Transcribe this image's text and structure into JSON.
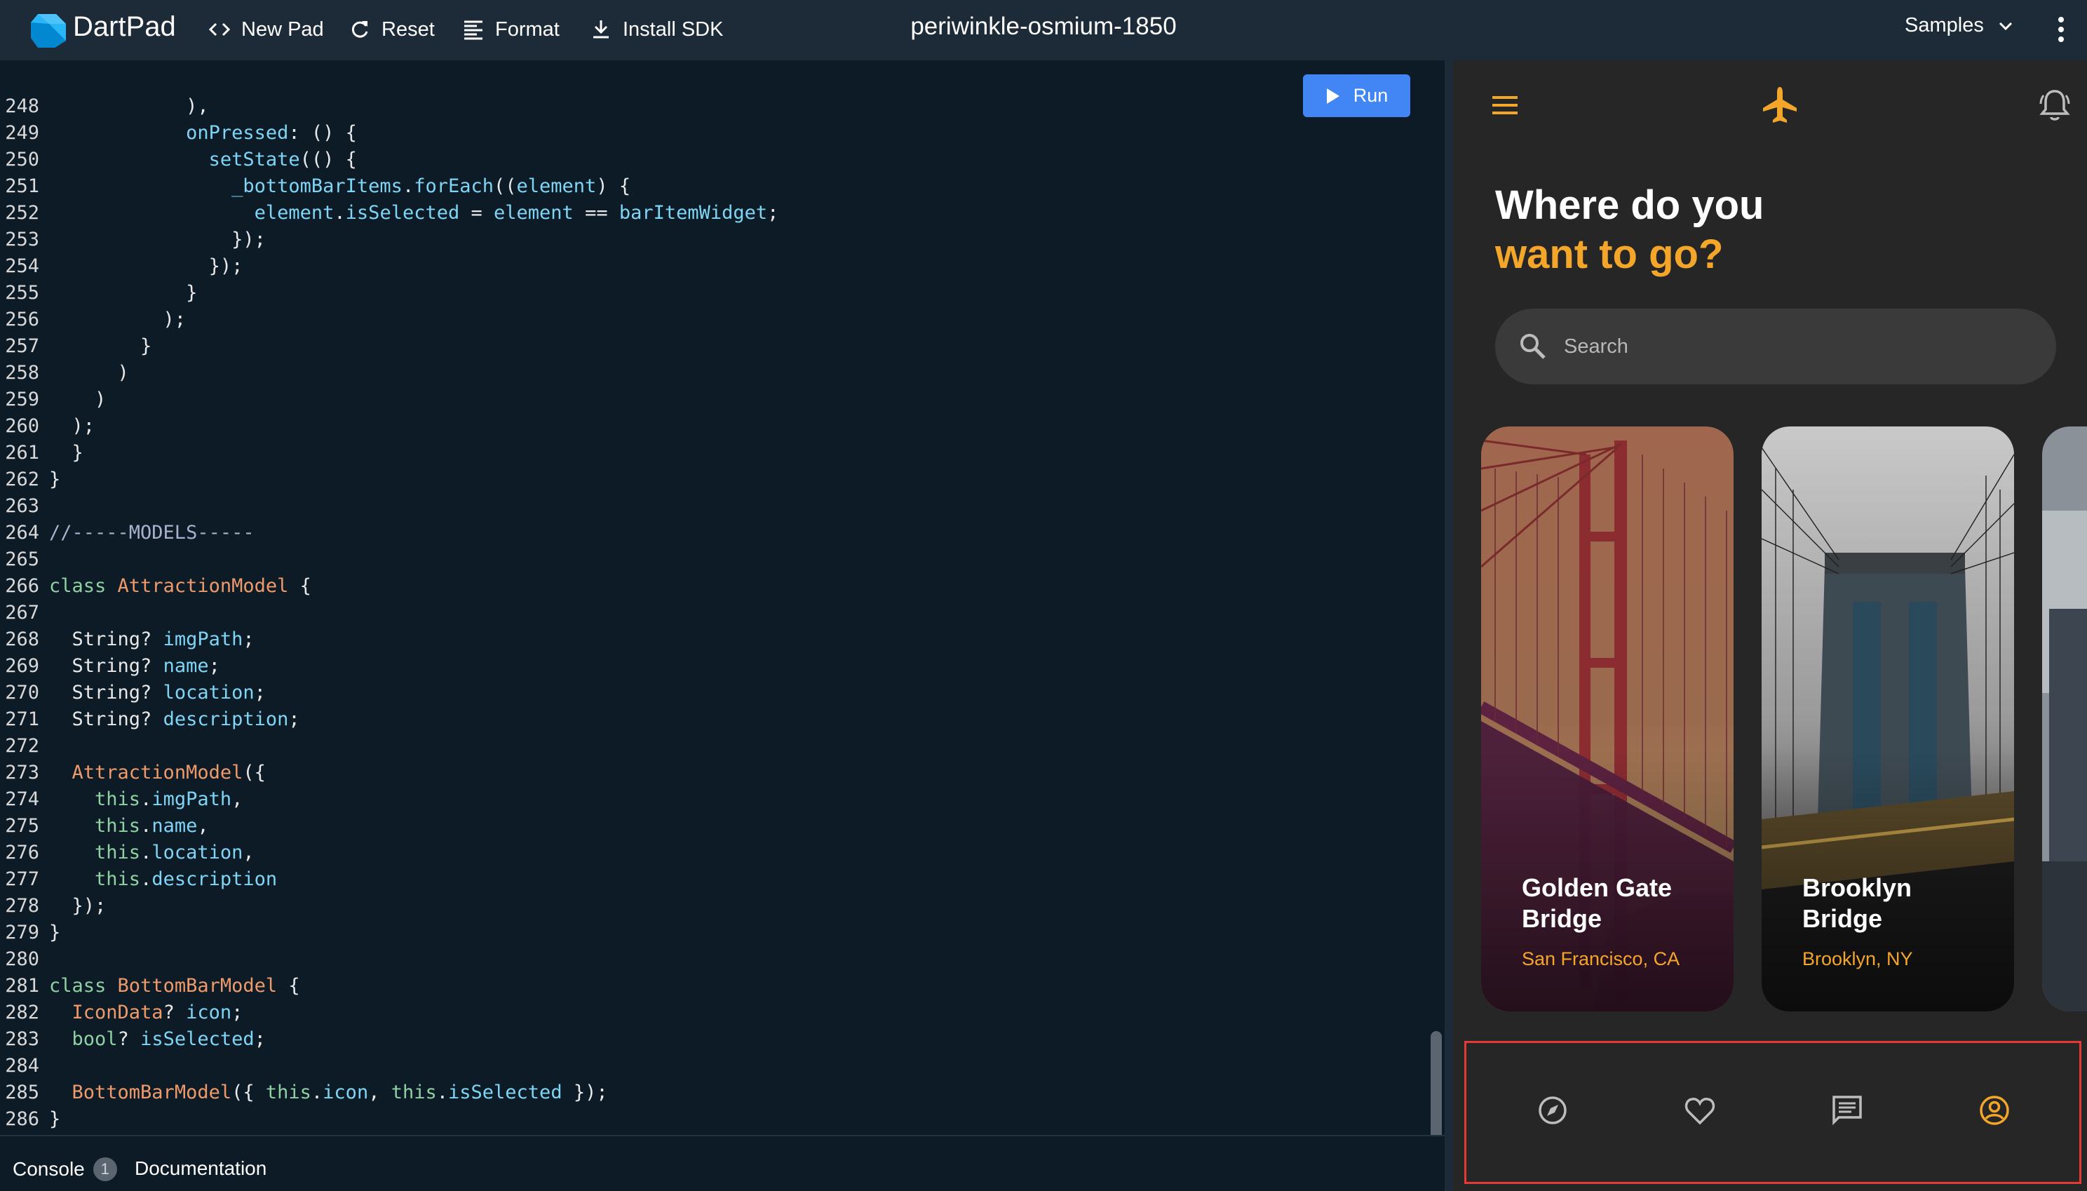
{
  "topbar": {
    "brand": "DartPad",
    "new_pad": "New Pad",
    "reset": "Reset",
    "format": "Format",
    "install_sdk": "Install SDK",
    "pad_name": "periwinkle-osmium-1850",
    "samples": "Samples"
  },
  "editor": {
    "run_label": "Run",
    "lines": [
      {
        "n": "248",
        "t": "            ),"
      },
      {
        "n": "249",
        "t": "            onPressed: () {"
      },
      {
        "n": "250",
        "t": "              setState(() {"
      },
      {
        "n": "251",
        "t": "                _bottomBarItems.forEach((element) {"
      },
      {
        "n": "252",
        "t": "                  element.isSelected = element == barItemWidget;"
      },
      {
        "n": "253",
        "t": "                });"
      },
      {
        "n": "254",
        "t": "              });"
      },
      {
        "n": "255",
        "t": "            }"
      },
      {
        "n": "256",
        "t": "          );"
      },
      {
        "n": "257",
        "t": "        }"
      },
      {
        "n": "258",
        "t": "      )"
      },
      {
        "n": "259",
        "t": "    )"
      },
      {
        "n": "260",
        "t": "  );"
      },
      {
        "n": "261",
        "t": "  }"
      },
      {
        "n": "262",
        "t": "}"
      },
      {
        "n": "263",
        "t": ""
      },
      {
        "n": "264",
        "t": "//-----MODELS-----"
      },
      {
        "n": "265",
        "t": ""
      },
      {
        "n": "266",
        "t": "class AttractionModel {"
      },
      {
        "n": "267",
        "t": ""
      },
      {
        "n": "268",
        "t": "  String? imgPath;"
      },
      {
        "n": "269",
        "t": "  String? name;"
      },
      {
        "n": "270",
        "t": "  String? location;"
      },
      {
        "n": "271",
        "t": "  String? description;"
      },
      {
        "n": "272",
        "t": ""
      },
      {
        "n": "273",
        "t": "  AttractionModel({"
      },
      {
        "n": "274",
        "t": "    this.imgPath,"
      },
      {
        "n": "275",
        "t": "    this.name,"
      },
      {
        "n": "276",
        "t": "    this.location,"
      },
      {
        "n": "277",
        "t": "    this.description"
      },
      {
        "n": "278",
        "t": "  });"
      },
      {
        "n": "279",
        "t": "}"
      },
      {
        "n": "280",
        "t": ""
      },
      {
        "n": "281",
        "t": "class BottomBarModel {"
      },
      {
        "n": "282",
        "t": "  IconData? icon;"
      },
      {
        "n": "283",
        "t": "  bool? isSelected;"
      },
      {
        "n": "284",
        "t": ""
      },
      {
        "n": "285",
        "t": "  BottomBarModel({ this.icon, this.isSelected });"
      },
      {
        "n": "286",
        "t": "}"
      }
    ]
  },
  "bottom_panel": {
    "console": "Console",
    "console_count": "1",
    "documentation": "Documentation"
  },
  "app": {
    "headline_line1": "Where do you",
    "headline_line2": "want to go?",
    "search_placeholder": "Search",
    "cards": [
      {
        "name_line1": "Golden Gate",
        "name_line2": "Bridge",
        "location": "San Francisco, CA"
      },
      {
        "name_line1": "Brooklyn",
        "name_line2": "Bridge",
        "location": "Brooklyn, NY"
      }
    ],
    "nav_icons": [
      "compass-icon",
      "heart-icon",
      "chat-icon",
      "account-icon"
    ],
    "accent_color": "#f4a62a",
    "inactive_icon_color": "#bdbdbd",
    "selected_nav": "account-icon"
  }
}
